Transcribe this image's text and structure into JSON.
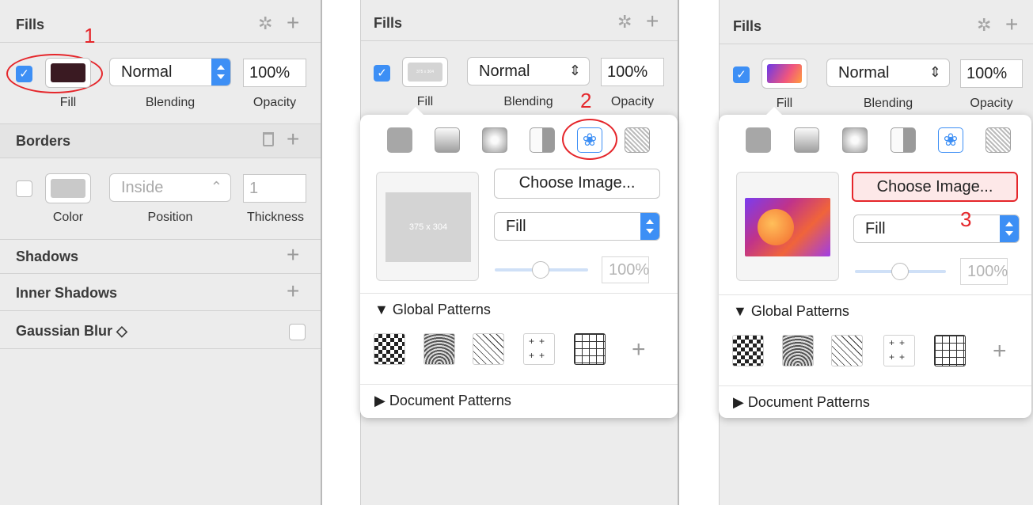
{
  "panel1": {
    "fills": {
      "title": "Fills",
      "fill_caption": "Fill",
      "blending": "Normal",
      "blending_caption": "Blending",
      "opacity": "100%",
      "opacity_caption": "Opacity",
      "fill_color": "#3a1a22"
    },
    "borders": {
      "title": "Borders",
      "position": "Inside",
      "position_caption": "Position",
      "color_caption": "Color",
      "thickness": "1",
      "thickness_caption": "Thickness",
      "border_color": "#c9c9c9"
    },
    "shadows": {
      "title": "Shadows"
    },
    "inner_shadows": {
      "title": "Inner Shadows"
    },
    "gaussian_blur": {
      "title": "Gaussian Blur ◇"
    },
    "marker": "1"
  },
  "panel2": {
    "fills": {
      "title": "Fills",
      "fill_caption": "Fill",
      "blending": "Normal",
      "blending_caption": "Blending",
      "opacity": "100%",
      "opacity_caption": "Opacity",
      "swatch_text": "375 x 304"
    },
    "popover": {
      "choose_image": "Choose Image...",
      "preview_text": "375 x 304",
      "mode": "Fill",
      "opacity": "100%",
      "global_patterns": "▼ Global Patterns",
      "document_patterns": "▶ Document Patterns"
    },
    "marker": "2"
  },
  "panel3": {
    "fills": {
      "title": "Fills",
      "fill_caption": "Fill",
      "blending": "Normal",
      "blending_caption": "Blending",
      "opacity": "100%",
      "opacity_caption": "Opacity"
    },
    "popover": {
      "choose_image": "Choose Image...",
      "mode": "Fill",
      "opacity": "100%",
      "global_patterns": "▼ Global Patterns",
      "document_patterns": "▶ Document Patterns"
    },
    "marker": "3"
  },
  "colors": {
    "accent": "#3d8ff5",
    "annotation_red": "#e5262b",
    "panel_bg": "#ececec"
  }
}
